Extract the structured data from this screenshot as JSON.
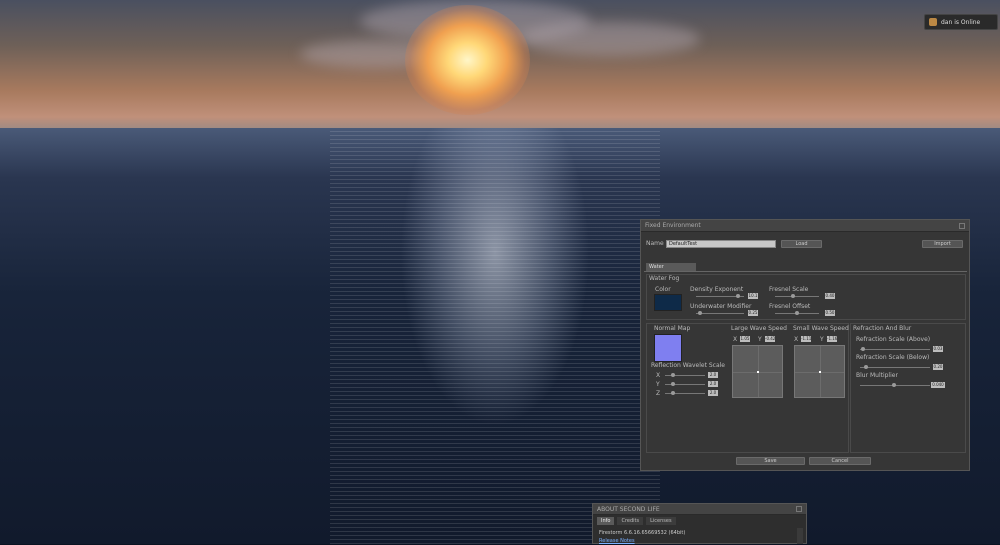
{
  "notification": {
    "text": "dan is Online"
  },
  "fixed_environment": {
    "title": "Fixed Environment",
    "name_label": "Name",
    "name_value": "DefaultTest",
    "load_button": "Load",
    "import_button": "Import",
    "tab": "Water",
    "water_fog": {
      "section": "Water Fog",
      "color_label": "Color",
      "color": "#0e2a48",
      "density_exponent_label": "Density Exponent",
      "density_exponent_value": "10.1",
      "underwater_modifier_label": "Underwater Modifier",
      "underwater_modifier_value": "0.25",
      "fresnel_scale_label": "Fresnel Scale",
      "fresnel_scale_value": "0.40",
      "fresnel_offset_label": "Fresnel Offset",
      "fresnel_offset_value": "0.50"
    },
    "normal_map": {
      "label": "Normal Map",
      "color": "#7f7ff0",
      "wavelet_label": "Reflection Wavelet Scale",
      "x_label": "X",
      "x_value": "2.0",
      "y_label": "Y",
      "y_value": "2.0",
      "z_label": "Z",
      "z_value": "2.0"
    },
    "large_wave": {
      "label": "Large Wave Speed",
      "x_label": "X",
      "x_value": "1.05",
      "y_label": "Y",
      "y_value": "-0.42"
    },
    "small_wave": {
      "label": "Small Wave Speed",
      "x_label": "X",
      "x_value": "-1.11",
      "y_label": "Y",
      "y_value": "-1.16"
    },
    "refraction": {
      "section": "Refraction And Blur",
      "above_label": "Refraction Scale (Above)",
      "above_value": "0.03",
      "below_label": "Refraction Scale (Below)",
      "below_value": "0.20",
      "blur_label": "Blur Multiplier",
      "blur_value": "0.040"
    },
    "save_button": "Save",
    "cancel_button": "Cancel"
  },
  "about": {
    "title": "ABOUT SECOND LIFE",
    "tabs": [
      "Info",
      "Credits",
      "Licenses"
    ],
    "version": "Firestorm 6.6.16.65669532 (64bit)",
    "link": "Release Notes"
  }
}
